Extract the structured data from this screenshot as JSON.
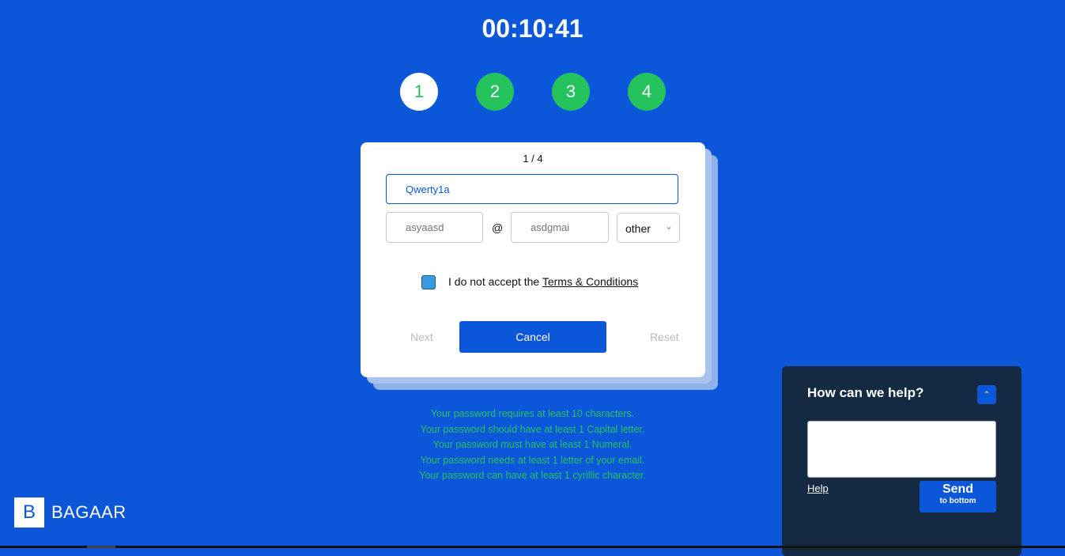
{
  "timer": "00:10:41",
  "steps": [
    {
      "label": "1",
      "active": true
    },
    {
      "label": "2"
    },
    {
      "label": "3"
    },
    {
      "label": "4"
    }
  ],
  "card": {
    "pager": "1 / 4",
    "password_value": "Qwerty1a",
    "email_user_placeholder": "asyaasd",
    "at": "@",
    "email_domain_placeholder": "asdgmai",
    "tld_selected": "other",
    "checkbox_label": "I do not accept the ",
    "terms_link": "Terms & Conditions",
    "next": "Next",
    "cancel": "Cancel",
    "reset": "Reset"
  },
  "rules": [
    "Your password requires at least 10 characters.",
    "Your password should have at least 1 Capital letter.",
    "Your password must have at least 1 Numeral.",
    "Your password needs at least 1 letter of your email.",
    "Your password can have at least 1 cyrillic character."
  ],
  "logo": {
    "letter": "B",
    "name": "BAGAAR"
  },
  "help": {
    "title": "How can we help?",
    "link": "Help",
    "send": "Send",
    "send_sub": "to bottom"
  },
  "colors": {
    "background": "#0b56d9",
    "success": "#25c35e",
    "help_panel": "#152a42"
  }
}
